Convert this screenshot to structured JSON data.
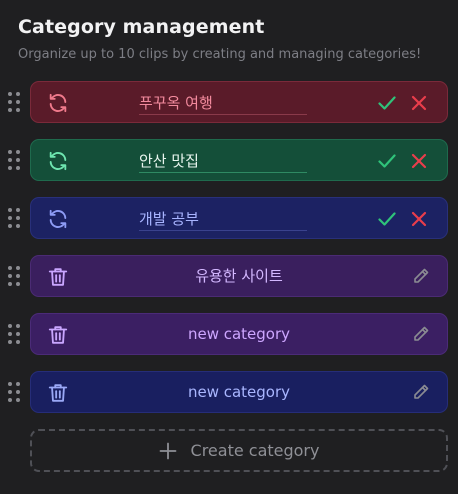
{
  "header": {
    "title": "Category management",
    "subtitle": "Organize up to 10 clips by creating and managing categories!"
  },
  "categories": [
    {
      "name": "푸꾸옥 여행",
      "mode": "editing",
      "theme": "red",
      "colors": {
        "text": "#f28a9d",
        "icon": "#f07a8c",
        "underline": "#8a3a4a"
      }
    },
    {
      "name": "안산 맛집",
      "mode": "editing",
      "theme": "green",
      "colors": {
        "text": "#e8f5ee",
        "icon": "#6ee6b0",
        "underline": "#2f8a63"
      }
    },
    {
      "name": "개발 공부",
      "mode": "editing",
      "theme": "navy",
      "colors": {
        "text": "#a8b4ff",
        "icon": "#8e9cf5",
        "underline": "#3a428e"
      }
    },
    {
      "name": "유용한 사이트",
      "mode": "view",
      "theme": "purple",
      "colors": {
        "text": "#d3b7ff",
        "icon": "#c9a6ff"
      }
    },
    {
      "name": "new category",
      "mode": "view",
      "theme": "purple2",
      "colors": {
        "text": "#cda6ff",
        "icon": "#c9a6ff"
      }
    },
    {
      "name": "new category",
      "mode": "view",
      "theme": "navy2",
      "colors": {
        "text": "#a9b6ff",
        "icon": "#9aa8f6"
      }
    }
  ],
  "row_icons": {
    "editing_lead": "refresh-icon",
    "view_lead": "trash-icon",
    "confirm": "check-icon",
    "cancel": "close-icon",
    "edit": "pencil-icon",
    "drag": "drag-handle-icon"
  },
  "actions": {
    "confirm_color": "#2fc37a",
    "cancel_color": "#ea3d4b",
    "pencil_color": "#8a8b92"
  },
  "create_button": {
    "label": "Create category",
    "icon": "plus-icon"
  }
}
